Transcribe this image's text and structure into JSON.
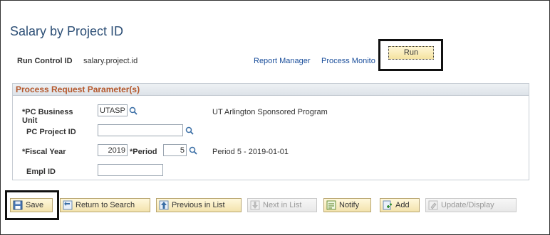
{
  "page": {
    "title": "Salary by Project ID"
  },
  "run_control": {
    "label": "Run Control ID",
    "value": "salary.project.id",
    "report_manager": "Report Manager",
    "process_monitor": "Process Monito",
    "run_label": "Run"
  },
  "params": {
    "header": "Process Request Parameter(s)",
    "business_unit_label": "*PC Business Unit",
    "business_unit_value": "UTASP",
    "business_unit_desc": "UT Arlington Sponsored Program",
    "project_id_label": "PC Project ID",
    "project_id_value": "",
    "fiscal_year_label": "*Fiscal Year",
    "fiscal_year_value": "2019",
    "period_label": "*Period",
    "period_value": "5",
    "period_desc": "Period 5 - 2019-01-01",
    "empl_id_label": "Empl ID",
    "empl_id_value": ""
  },
  "toolbar": {
    "save": "Save",
    "return_to_search": "Return to Search",
    "previous_in_list": "Previous in List",
    "next_in_list": "Next in List",
    "notify": "Notify",
    "add": "Add",
    "update_display": "Update/Display"
  },
  "colors": {
    "title": "#2d4f76",
    "link": "#1a4e9b",
    "group_header_text": "#b4572b",
    "button_bg": "#f3e3ad"
  }
}
